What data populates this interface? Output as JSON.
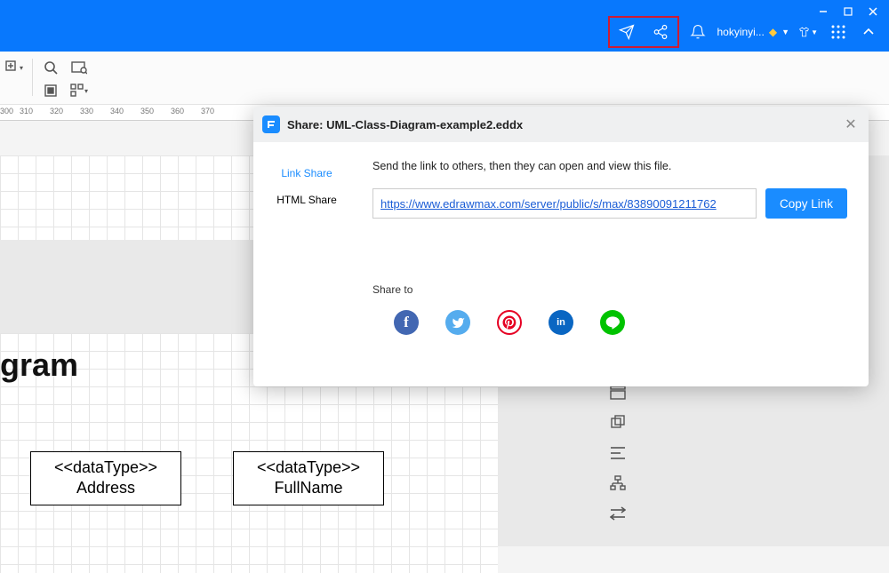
{
  "titlebar": {
    "user_name": "hokyinyi...",
    "icons": {
      "send": "send-icon",
      "share": "share-icon",
      "bell": "bell-icon",
      "diamond": "diamond-icon",
      "shirt": "shirt-icon",
      "grid": "apps-icon",
      "expand": "chevron-up-icon"
    }
  },
  "toolbar": {
    "icons": [
      "add",
      "search",
      "preview",
      "fit",
      "layout"
    ]
  },
  "ruler": {
    "start": 300,
    "step": 10,
    "count": 9
  },
  "canvas": {
    "title_fragment": "gram",
    "class1": {
      "stereotype": "<<dataType>>",
      "name": "Address"
    },
    "class2": {
      "stereotype": "<<dataType>>",
      "name": "FullName"
    }
  },
  "dialog": {
    "title": "Share: UML-Class-Diagram-example2.eddx",
    "tabs": {
      "link": "Link Share",
      "html": "HTML Share"
    },
    "desc": "Send the link to others, then they can open and view this file.",
    "link_url": "https://www.edrawmax.com/server/public/s/max/83890091211762",
    "copy_label": "Copy Link",
    "share_to_label": "Share to",
    "share_targets": [
      {
        "name": "facebook",
        "letter": "f",
        "color": "#4267B2"
      },
      {
        "name": "twitter",
        "letter": "",
        "color": "#55acee"
      },
      {
        "name": "pinterest",
        "letter": "p",
        "color": "#e60023"
      },
      {
        "name": "linkedin",
        "letter": "in",
        "color": "#0a66c2"
      },
      {
        "name": "line",
        "letter": "",
        "color": "#00c300"
      }
    ]
  }
}
